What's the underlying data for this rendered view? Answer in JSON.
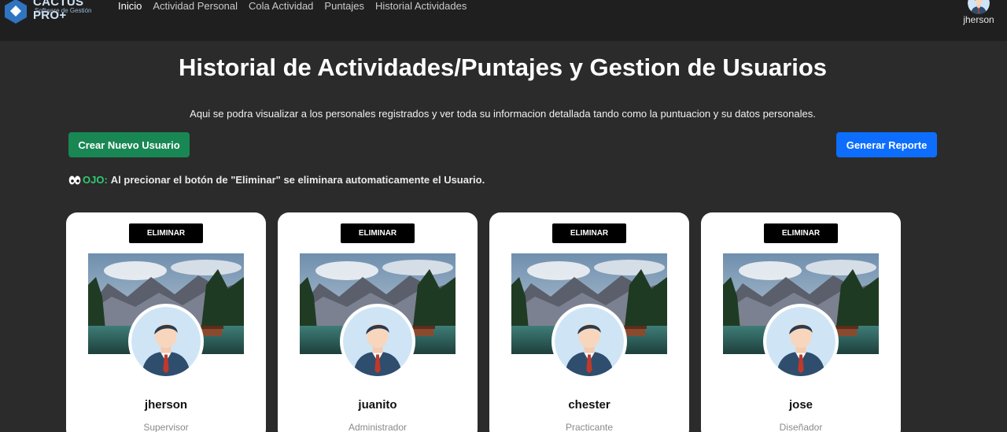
{
  "brand": {
    "name": "CACTUS PRO+",
    "subtitle": "Software de Gestión",
    "accent": "#2f74c0"
  },
  "nav": {
    "links": [
      {
        "label": "Inicio",
        "active": true
      },
      {
        "label": "Actividad Personal",
        "active": false
      },
      {
        "label": "Cola Actividad",
        "active": false
      },
      {
        "label": "Puntajes",
        "active": false
      },
      {
        "label": "Historial Actividades",
        "active": false
      }
    ],
    "user": {
      "name": "jherson"
    }
  },
  "header": {
    "title": "Historial de Actividades/Puntajes y Gestion de Usuarios",
    "description": "Aqui se podra visualizar a los personales registrados y ver toda su informacion detallada tando como la puntuacion y su datos personales."
  },
  "actions": {
    "create_label": "Crear Nuevo Usuario",
    "create_color": "#198754",
    "report_label": "Generar Reporte",
    "report_color": "#0d6efd"
  },
  "warning": {
    "icon": "eyes-icon",
    "label": "OJO:",
    "text": "Al precionar el botón de \"Eliminar\" se eliminara automaticamente el Usuario."
  },
  "users": [
    {
      "name": "jherson",
      "role": "Supervisor",
      "delete_label": "ELIMINAR"
    },
    {
      "name": "juanito",
      "role": "Administrador",
      "delete_label": "ELIMINAR"
    },
    {
      "name": "chester",
      "role": "Practicante",
      "delete_label": "ELIMINAR"
    },
    {
      "name": "jose",
      "role": "Diseñador",
      "delete_label": "ELIMINAR"
    }
  ]
}
